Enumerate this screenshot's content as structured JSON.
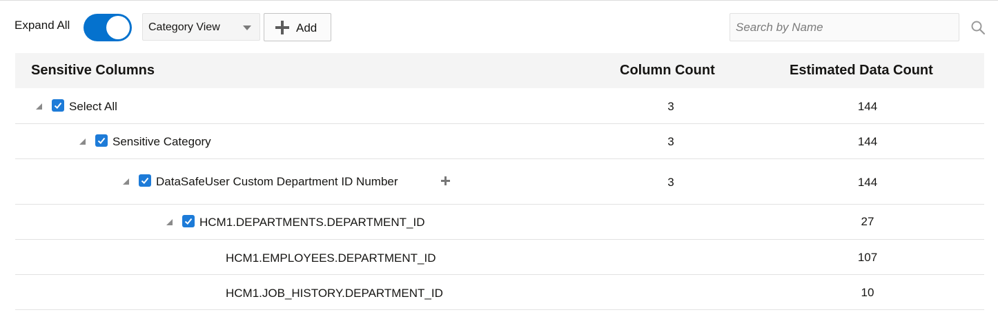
{
  "toolbar": {
    "expand_all_label": "Expand All",
    "expand_all_on": true,
    "view_select_value": "Category View",
    "add_label": "Add",
    "search_placeholder": "Search by Name"
  },
  "table": {
    "headers": {
      "name": "Sensitive Columns",
      "column_count": "Column Count",
      "estimated_data_count": "Estimated Data Count"
    },
    "rows": [
      {
        "name": "Select All",
        "column_count": "3",
        "estimated_data_count": "144",
        "checked": true,
        "expanded": true
      },
      {
        "name": "Sensitive Category",
        "column_count": "3",
        "estimated_data_count": "144",
        "checked": true,
        "expanded": true
      },
      {
        "name": "DataSafeUser Custom Department ID Number",
        "column_count": "3",
        "estimated_data_count": "144",
        "checked": true,
        "expanded": true
      },
      {
        "name": "HCM1.DEPARTMENTS.DEPARTMENT_ID",
        "column_count": "",
        "estimated_data_count": "27",
        "checked": true,
        "expanded": true
      },
      {
        "name": "HCM1.EMPLOYEES.DEPARTMENT_ID",
        "column_count": "",
        "estimated_data_count": "107"
      },
      {
        "name": "HCM1.JOB_HISTORY.DEPARTMENT_ID",
        "column_count": "",
        "estimated_data_count": "10"
      }
    ]
  },
  "colors": {
    "accent": "#0572ce",
    "checkbox": "#1d7bd8",
    "header_bg": "#f4f4f4"
  },
  "icons": {
    "search": "search-icon",
    "add": "plus-icon",
    "expand": "expand-triangle-icon"
  }
}
